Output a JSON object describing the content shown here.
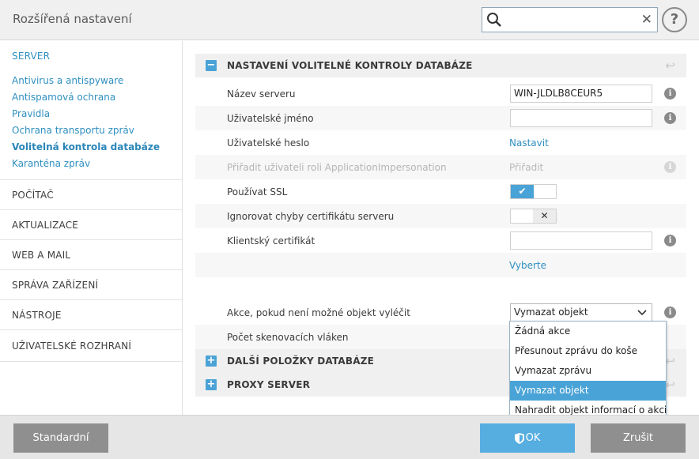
{
  "window": {
    "title": "Rozšířená nastavení"
  },
  "search": {
    "placeholder": "",
    "clear": "✕"
  },
  "help": {
    "label": "?"
  },
  "sidebar": {
    "server_heading": "SERVER",
    "server_items": [
      "Antivirus a antispyware",
      "Antispamová ochrana",
      "Pravidla",
      "Ochrana transportu zpráv",
      "Volitelná kontrola databáze",
      "Karanténa zpráv"
    ],
    "active_item": "Volitelná kontrola databáze",
    "sections": [
      "POČÍTAČ",
      "AKTUALIZACE",
      "WEB A MAIL",
      "SPRÁVA ZAŘÍZENÍ",
      "NÁSTROJE",
      "UŽIVATELSKÉ ROZHRANÍ"
    ]
  },
  "main": {
    "section1": {
      "title": "NASTAVENÍ VOLITELNÉ KONTROLY DATABÁZE",
      "toggle": "−"
    },
    "rows": {
      "server_name": {
        "label": "Název serveru",
        "value": "WIN-JLDLB8CEUR5"
      },
      "user_name": {
        "label": "Uživatelské jméno",
        "value": ""
      },
      "user_password": {
        "label": "Uživatelské heslo",
        "link": "Nastavit"
      },
      "impersonation": {
        "label": "Přiřadit uživateli roli ApplicationImpersonation",
        "link": "Přiřadit"
      },
      "use_ssl": {
        "label": "Používat SSL",
        "state": "on",
        "icon": "✔"
      },
      "ignore_cert": {
        "label": "Ignorovat chyby certifikátu serveru",
        "state": "off",
        "icon": "✕"
      },
      "client_cert": {
        "label": "Klientský certifikát",
        "value": "",
        "link": "Vyberte"
      },
      "action": {
        "label": "Akce, pokud není možné objekt vyléčit",
        "selected": "Vymazat objekt"
      },
      "threads": {
        "label": "Počet skenovacích vláken"
      }
    },
    "section2": {
      "title": "DALŠÍ POLOŽKY DATABÁZE",
      "toggle": "+"
    },
    "section3": {
      "title": "PROXY SERVER",
      "toggle": "+"
    },
    "dropdown_options": [
      "Žádná akce",
      "Přesunout zprávu do koše",
      "Vymazat zprávu",
      "Vymazat objekt",
      "Nahradit objekt informací o akci"
    ],
    "info_glyph": "i"
  },
  "footer": {
    "default_label": "Standardní",
    "ok_label": "OK",
    "cancel_label": "Zrušit"
  },
  "colors": {
    "accent": "#4aa3d6",
    "link": "#2f8fc0",
    "button_gray": "#8f8f8f"
  }
}
